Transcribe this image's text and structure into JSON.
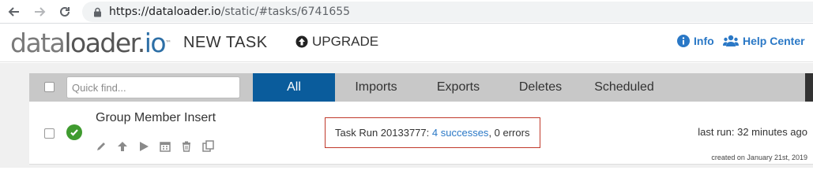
{
  "browser": {
    "url_host": "https://dataloader.io",
    "url_path": "/static/#tasks/6741655"
  },
  "header": {
    "logo_part1": "data",
    "logo_part2": "loader.",
    "logo_part3": "io",
    "logo_tm": "™",
    "new_task_label": "NEW TASK",
    "upgrade_label": "UPGRADE",
    "info_label": "Info",
    "help_center_label": "Help Center"
  },
  "toolbar": {
    "quickfind_placeholder": "Quick find...",
    "tabs": [
      {
        "label": "All",
        "active": true
      },
      {
        "label": "Imports",
        "active": false
      },
      {
        "label": "Exports",
        "active": false
      },
      {
        "label": "Deletes",
        "active": false
      },
      {
        "label": "Scheduled",
        "active": false
      }
    ]
  },
  "task": {
    "name": "Group Member Insert",
    "status": "success",
    "run_prefix": "Task Run 20133777: ",
    "run_successes": "4 successes",
    "run_suffix": ", 0 errors",
    "last_run": "last run: 32 minutes ago",
    "created": "created on January 21st, 2019",
    "actions": [
      "edit-icon",
      "upload-icon",
      "play-icon",
      "calendar-icon",
      "trash-icon",
      "copy-icon"
    ]
  },
  "colors": {
    "accent": "#0a5c9c",
    "link": "#2a78c6",
    "success": "#3f9b2f",
    "run_border": "#c0392b"
  }
}
